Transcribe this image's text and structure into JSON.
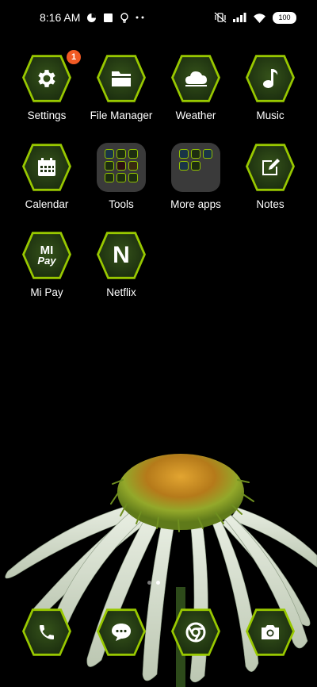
{
  "status_bar": {
    "time": "8:16 AM",
    "battery": "100"
  },
  "apps": [
    {
      "name": "settings",
      "label": "Settings",
      "badge": "1",
      "icon": "gear-icon"
    },
    {
      "name": "file-manager",
      "label": "File Manager",
      "icon": "folder-icon"
    },
    {
      "name": "weather",
      "label": "Weather",
      "icon": "cloud-sun-icon"
    },
    {
      "name": "music",
      "label": "Music",
      "icon": "music-note-icon"
    },
    {
      "name": "calendar",
      "label": "Calendar",
      "icon": "calendar-icon"
    },
    {
      "name": "tools",
      "label": "Tools",
      "icon": "folder-group-icon"
    },
    {
      "name": "more-apps",
      "label": "More apps",
      "icon": "folder-group-icon"
    },
    {
      "name": "notes",
      "label": "Notes",
      "icon": "edit-note-icon"
    },
    {
      "name": "mi-pay",
      "label": "Mi Pay",
      "icon": "mi-pay-icon",
      "icon_text_top": "MI",
      "icon_text_bottom": "Pay"
    },
    {
      "name": "netflix",
      "label": "Netflix",
      "icon": "netflix-icon",
      "icon_text": "N"
    }
  ],
  "dock": [
    {
      "name": "phone",
      "icon": "phone-icon"
    },
    {
      "name": "messages",
      "icon": "chat-icon"
    },
    {
      "name": "browser",
      "icon": "chrome-icon"
    },
    {
      "name": "camera",
      "icon": "camera-icon"
    }
  ],
  "page_indicator": {
    "pages": 2,
    "current": 2
  },
  "colors": {
    "accent": "#98c800",
    "badge": "#f15a24",
    "icon_bg": "#1e3210",
    "folder_bg": "#3a3a3a"
  }
}
